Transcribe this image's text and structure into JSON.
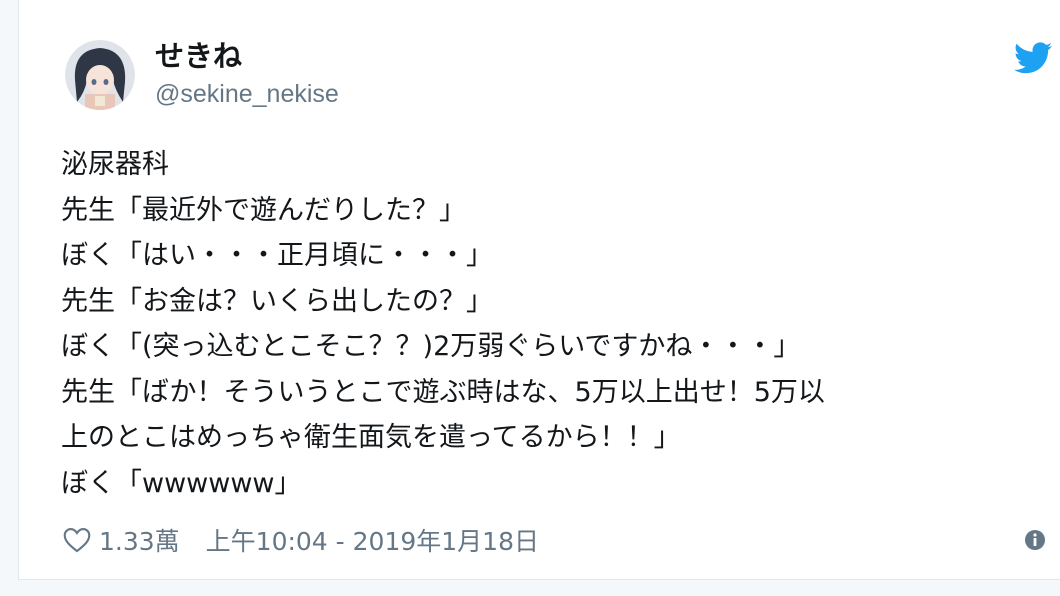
{
  "tweet": {
    "display_name": "せきね",
    "handle": "@sekine_nekise",
    "lines": [
      "泌尿器科",
      "先生「最近外で遊んだりした？」",
      "ぼく「はい・・・正月頃に・・・」",
      "先生「お金は？いくら出したの？」",
      "ぼく「(突っ込むとこそこ？？)2万弱ぐらいですかね・・・」",
      "先生「ばか！そういうとこで遊ぶ時はな、5万以上出せ！5万以",
      "上のとこはめっちゃ衛生面気を遣ってるから！！」",
      "ぼく「wwwwww」"
    ],
    "likes": "1.33萬",
    "timestamp": "上午10:04 - 2019年1月18日"
  },
  "icons": {
    "logo": "twitter-bird-icon",
    "like": "heart-icon",
    "info": "info-icon"
  },
  "colors": {
    "twitter_blue": "#1da1f2",
    "text": "#14171a",
    "secondary": "#657786"
  }
}
